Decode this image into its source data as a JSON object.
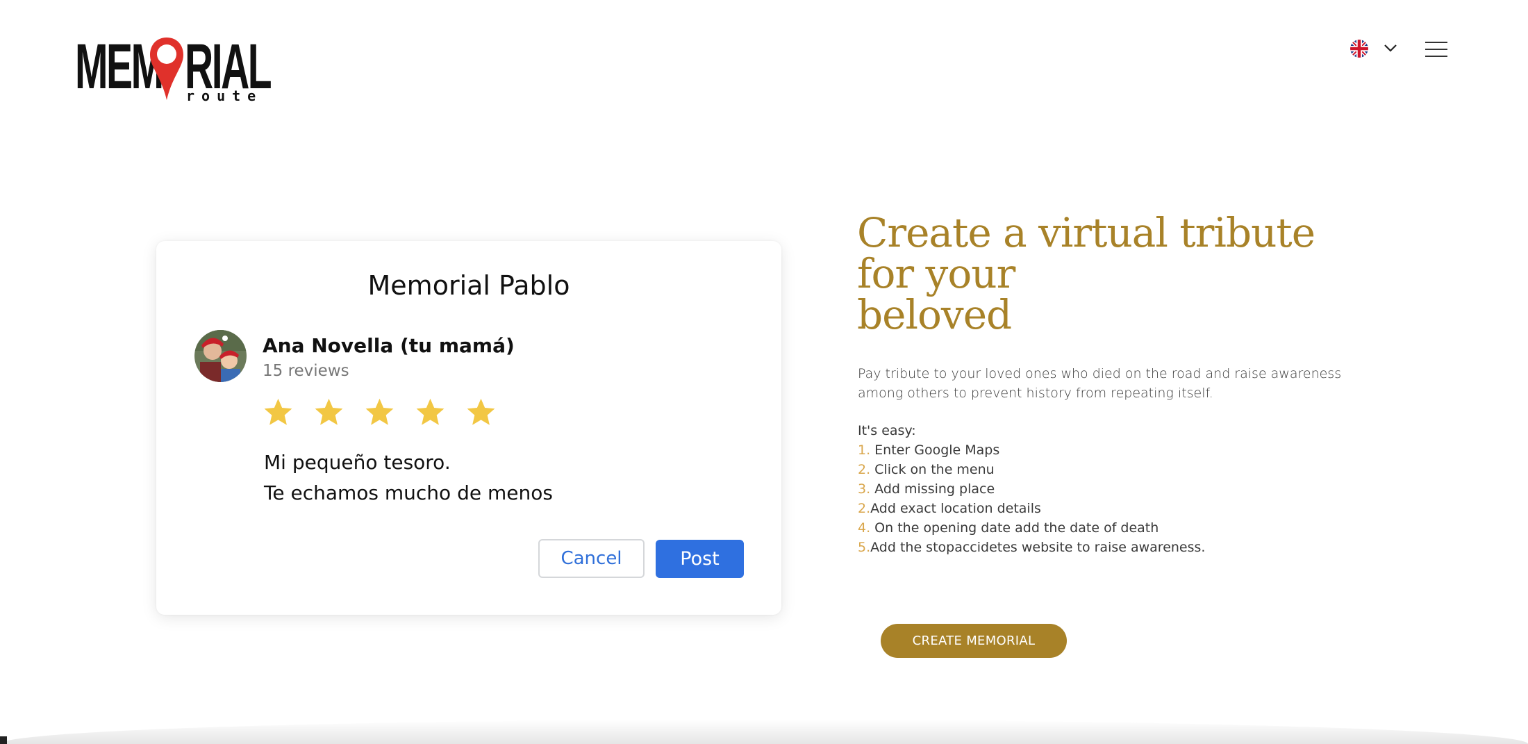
{
  "header": {
    "logo_main_left": "MEM",
    "logo_main_right": "RIAL",
    "logo_sub": "route",
    "language_flag": "uk-flag-icon",
    "language_toggle_icon": "chevron-down-icon",
    "menu_icon": "hamburger-menu-icon"
  },
  "card": {
    "title": "Memorial Pablo",
    "author": "Ana Novella (tu mamá)",
    "reviews": "15 reviews",
    "rating": 5,
    "rating_max": 5,
    "message_line1": "Mi pequeño tesoro.",
    "message_line2": "Te echamos mucho de menos",
    "cancel_label": "Cancel",
    "post_label": "Post"
  },
  "tribute": {
    "heading_line1": "Create a virtual tribute",
    "heading_line2": "for your",
    "heading_line3": "beloved",
    "intro_line1": "Pay tribute to your loved ones who died on the road and raise awareness",
    "intro_line2": "among others to prevent history from repeating itself.",
    "easy_label": "It's easy:",
    "steps": [
      {
        "num": "1.",
        "text": " Enter Google Maps"
      },
      {
        "num": "2.",
        "text": " Click on the menu"
      },
      {
        "num": "3.",
        "text": " Add missing place"
      },
      {
        "num": "2.",
        "text": "Add exact location details"
      },
      {
        "num": "4.",
        "text": " On the opening date add the date of death"
      },
      {
        "num": "5.",
        "text": "Add the stopaccidetes website to raise awareness."
      }
    ],
    "cta_label": "CREATE MEMORIAL"
  },
  "colors": {
    "gold": "#a88228",
    "step_number": "#d9a64b",
    "post_blue": "#2f70e0",
    "cancel_text": "#2f6fd9",
    "star": "#f2c744",
    "pin_red": "#e0312b"
  }
}
